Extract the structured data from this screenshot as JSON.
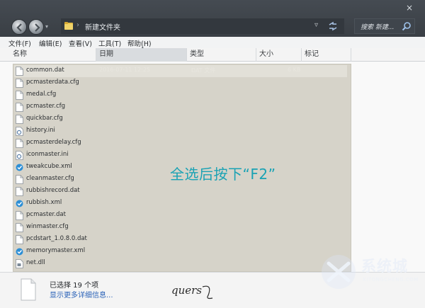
{
  "window": {
    "close_glyph": "×"
  },
  "address": {
    "path": "新建文件夹",
    "chevron": "›",
    "dropdown": "▿"
  },
  "search": {
    "placeholder": "搜索 新建..."
  },
  "menu": [
    {
      "label": "文件(F)"
    },
    {
      "label": "编辑(E)"
    },
    {
      "label": "查看(V)"
    },
    {
      "label": "工具(T)"
    },
    {
      "label": "帮助(H)"
    }
  ],
  "columns": [
    {
      "label": "名称"
    },
    {
      "label": "日期"
    },
    {
      "label": "类型"
    },
    {
      "label": "大小"
    },
    {
      "label": "标记"
    }
  ],
  "files": [
    {
      "name": "common.dat",
      "date": "2016-07-11 12:25",
      "type": "DAT 文件",
      "size": "6 KB",
      "icon": "file-icon"
    },
    {
      "name": "pcmasterdata.cfg",
      "icon": "file-icon"
    },
    {
      "name": "medal.cfg",
      "icon": "file-icon"
    },
    {
      "name": "pcmaster.cfg",
      "icon": "file-icon"
    },
    {
      "name": "quickbar.cfg",
      "icon": "file-icon"
    },
    {
      "name": "history.ini",
      "icon": "settings-file-icon"
    },
    {
      "name": "pcmasterdelay.cfg",
      "icon": "file-icon"
    },
    {
      "name": "iconmaster.ini",
      "icon": "settings-file-icon"
    },
    {
      "name": "tweakcube.xml",
      "icon": "xml-file-icon"
    },
    {
      "name": "cleanmaster.cfg",
      "icon": "file-icon"
    },
    {
      "name": "rubbishrecord.dat",
      "icon": "file-icon"
    },
    {
      "name": "rubbish.xml",
      "icon": "xml-file-icon"
    },
    {
      "name": "pcmaster.dat",
      "icon": "file-icon"
    },
    {
      "name": "winmaster.cfg",
      "icon": "file-icon"
    },
    {
      "name": "pcdstart_1.0.8.0.dat",
      "icon": "file-icon"
    },
    {
      "name": "memorymaster.xml",
      "icon": "xml-file-icon"
    },
    {
      "name": "net.dll",
      "icon": "dll-file-icon"
    }
  ],
  "overlay_text": "全选后按下“F2”",
  "status": {
    "count": "已选择 19 个项",
    "details_link": "显示更多详细信息..."
  },
  "signature": "quers",
  "watermark": {
    "text": "系统城",
    "sub": "XITONGCHENG.COM"
  },
  "colors": {
    "selection": "#d6d3c9",
    "overlay": "#1aa2b4",
    "titlebar": "#3a3f45",
    "link": "#2c63b8"
  }
}
